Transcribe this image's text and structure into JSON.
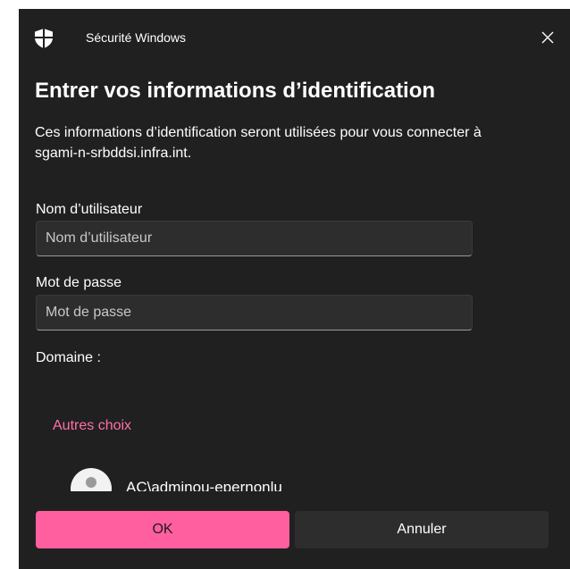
{
  "window": {
    "title": "Sécurité Windows",
    "shield_icon": "shield-icon",
    "close_icon": "close-icon"
  },
  "heading": "Entrer vos informations d’identification",
  "description": "Ces informations d’identification seront utilisées pour vous connecter à sgami-n-srbddsi.infra.int.",
  "username": {
    "label": "Nom d’utilisateur",
    "placeholder": "Nom d’utilisateur",
    "value": ""
  },
  "password": {
    "label": "Mot de passe",
    "placeholder": "Mot de passe",
    "value": ""
  },
  "domain": {
    "label": "Domaine :"
  },
  "other_choices": {
    "label": "Autres choix",
    "account": {
      "icon": "user-avatar-icon",
      "name": "AC\\adminou-epernonlu"
    }
  },
  "buttons": {
    "ok": "OK",
    "cancel": "Annuler"
  },
  "colors": {
    "dialog_bg": "#202020",
    "accent": "#ff5f9e",
    "link": "#ff6fa8",
    "input_bg": "#2d2d2d"
  }
}
